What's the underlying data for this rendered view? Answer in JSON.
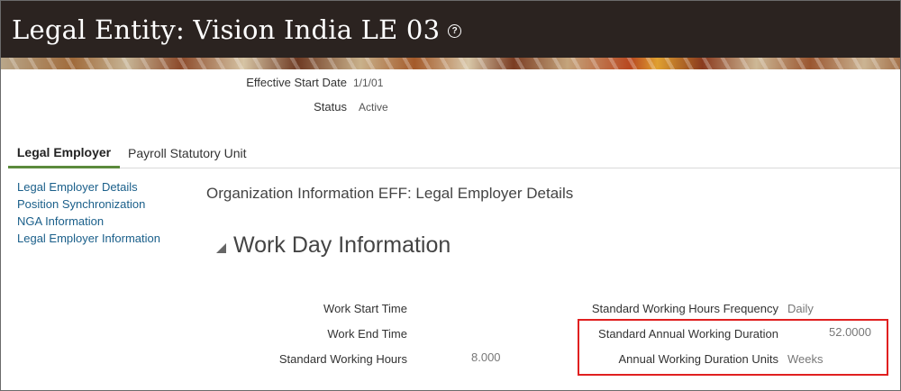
{
  "header": {
    "title": "Legal Entity: Vision India LE 03",
    "help_icon": "question-circle-icon"
  },
  "meta": {
    "effective_start_date_label": "Effective Start Date",
    "effective_start_date_value": "1/1/01",
    "status_label": "Status",
    "status_value": "Active"
  },
  "tabs": [
    {
      "label": "Legal Employer",
      "active": true
    },
    {
      "label": "Payroll Statutory Unit",
      "active": false
    }
  ],
  "side_links": [
    "Legal Employer Details",
    "Position Synchronization",
    "NGA Information",
    "Legal Employer Information"
  ],
  "main": {
    "eff_title": "Organization Information EFF: Legal Employer Details",
    "section_title": "Work Day Information",
    "left_fields": {
      "work_start_time_label": "Work Start Time",
      "work_end_time_label": "Work End Time",
      "standard_working_hours_label": "Standard Working Hours",
      "standard_working_hours_value": "8.000"
    },
    "right_fields": {
      "frequency_label": "Standard Working Hours Frequency",
      "frequency_value": "Daily",
      "annual_duration_label": "Standard Annual Working Duration",
      "annual_duration_value": "52.0000",
      "duration_units_label": "Annual Working Duration Units",
      "duration_units_value": "Weeks"
    }
  },
  "colors": {
    "header_bg": "#2b2320",
    "tab_active_underline": "#5b8a3c",
    "link": "#1a5f8a",
    "highlight_border": "#e02020"
  }
}
